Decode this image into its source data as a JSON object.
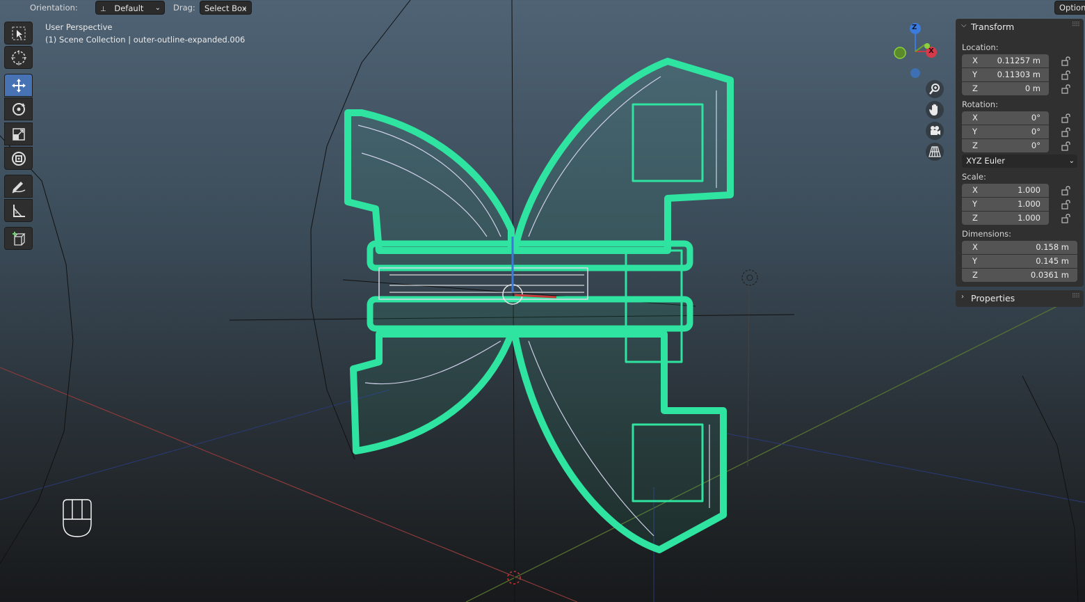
{
  "header": {
    "orientation_label": "Orientation:",
    "orientation_value": "Default",
    "drag_label": "Drag:",
    "drag_value": "Select Box",
    "options_label": "Options"
  },
  "viewport": {
    "view_name": "User Perspective",
    "collection_info": "(1) Scene Collection | outer-outline-expanded.006",
    "object_color": "#2fe3a0"
  },
  "gizmo": {
    "x_label": "X",
    "z_label": "Z"
  },
  "toolbar": {
    "tools": [
      "select-box",
      "cursor",
      "move",
      "rotate",
      "scale",
      "transform",
      "annotate",
      "measure",
      "add-cube"
    ],
    "active_tool": "move"
  },
  "sidebar": {
    "transform_title": "Transform",
    "location_label": "Location:",
    "location": [
      {
        "axis": "X",
        "value": "0.11257 m"
      },
      {
        "axis": "Y",
        "value": "0.11303 m"
      },
      {
        "axis": "Z",
        "value": "0 m"
      }
    ],
    "rotation_label": "Rotation:",
    "rotation": [
      {
        "axis": "X",
        "value": "0°"
      },
      {
        "axis": "Y",
        "value": "0°"
      },
      {
        "axis": "Z",
        "value": "0°"
      }
    ],
    "rotation_mode": "XYZ Euler",
    "scale_label": "Scale:",
    "scale": [
      {
        "axis": "X",
        "value": "1.000"
      },
      {
        "axis": "Y",
        "value": "1.000"
      },
      {
        "axis": "Z",
        "value": "1.000"
      }
    ],
    "dimensions_label": "Dimensions:",
    "dimensions": [
      {
        "axis": "X",
        "value": "0.158 m"
      },
      {
        "axis": "Y",
        "value": "0.145 m"
      },
      {
        "axis": "Z",
        "value": "0.0361 m"
      }
    ],
    "properties_title": "Properties"
  }
}
